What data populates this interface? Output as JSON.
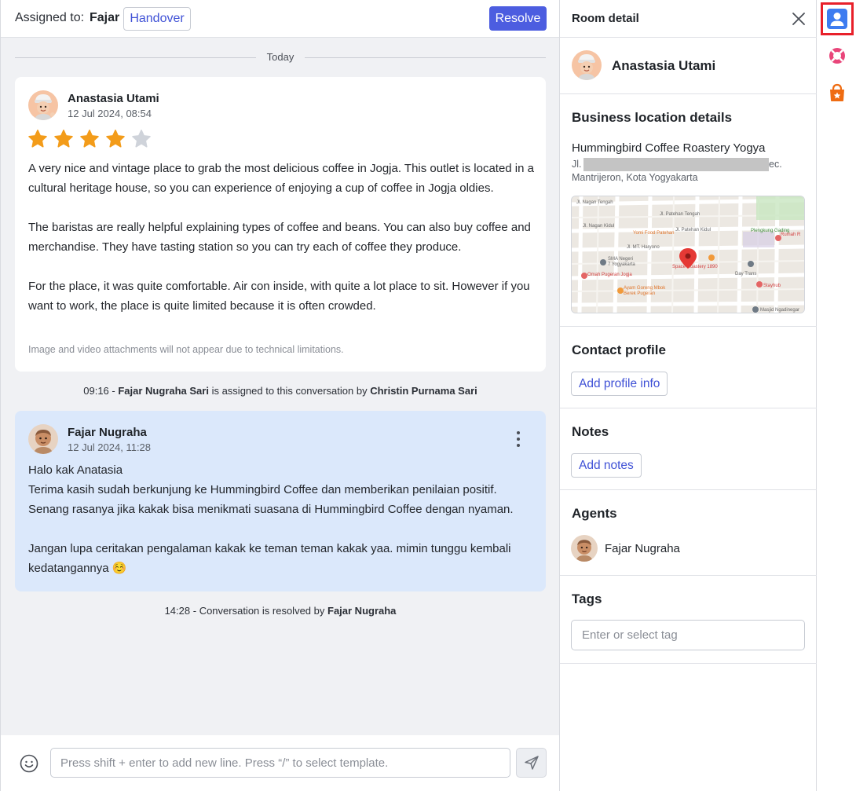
{
  "header": {
    "assigned_label": "Assigned to:",
    "assigned_name": "Fajar",
    "handover_label": "Handover",
    "resolve_label": "Resolve"
  },
  "conversation": {
    "date_divider": "Today",
    "review": {
      "sender": "Anastasia Utami",
      "timestamp": "12 Jul 2024, 08:54",
      "rating": 4,
      "rating_max": 5,
      "text": "A very nice and vintage place to grab the most delicious coffee in Jogja. This outlet is located in a cultural heritage house, so you can experience of enjoying a cup of coffee in Jogja oldies.\n\nThe baristas are really helpful explaining types of coffee and beans. You can also buy coffee and merchandise. They have tasting station so you can try each of coffee they produce.\n\nFor the place, it was quite comfortable. Air con inside, with quite a lot place to sit. However if you want to work, the place is quite limited because it is often crowded.",
      "attachment_note": "Image and video attachments will not appear due to technical limitations."
    },
    "system_assign": {
      "time": "09:16",
      "separator": " - ",
      "agent": "Fajar Nugraha Sari",
      "middle": " is assigned to this conversation by ",
      "by": "Christin Purnama Sari"
    },
    "reply": {
      "sender": "Fajar Nugraha",
      "timestamp": "12 Jul 2024, 11:28",
      "text": "Halo kak Anatasia\nTerima kasih sudah berkunjung ke Hummingbird Coffee dan memberikan penilaian positif. Senang rasanya jika kakak bisa menikmati suasana di Hummingbird Coffee dengan nyaman.\n\nJangan lupa ceritakan pengalaman kakak ke teman teman kakak yaa. mimin tunggu kembali kedatangannya ☺️"
    },
    "system_resolve": {
      "time": "14:28",
      "separator": " - ",
      "middle": "Conversation is resolved by ",
      "by": "Fajar Nugraha"
    }
  },
  "composer": {
    "placeholder": "Press shift + enter to add new line. Press “/” to select template."
  },
  "detail": {
    "title": "Room detail",
    "contact_name": "Anastasia Utami",
    "business": {
      "title": "Business location details",
      "name": "Hummingbird Coffee Roastery Yogya",
      "address_start": "Jl.",
      "address_end": "ec.",
      "address_line2": "Mantrijeron, Kota Yogyakarta",
      "map_labels": {
        "jl_nagan_tengah": "Jl. Nagan Tengah",
        "jl_patehan_tengah": "Jl. Patehan Tengah",
        "jl_nagan_kidul": "Jl. Nagan Kidul",
        "yomi": "Yomi Food Patehan",
        "jl_patehan_kidul": "Jl. Patehan Kidul",
        "jl_mt_haryono": "Jl. MT. Haryono",
        "sma": "SMA Negeri",
        "sma2": "7 Yogyakarta",
        "space": "Space Roastery 1890",
        "omah": "Omah Pugeran Jogja",
        "ayam": "Ayam Goreng Mbok",
        "ayam2": "Berek Pugeran",
        "day_trans": "Day Trans",
        "stayhub": "Stayhub",
        "plengkung": "Plengkung Gading",
        "rumah": "Rumah R",
        "masjid": "Masjid Ngadinegar"
      }
    },
    "profile": {
      "title": "Contact profile",
      "button": "Add profile info"
    },
    "notes": {
      "title": "Notes",
      "button": "Add notes"
    },
    "agents": {
      "title": "Agents",
      "name": "Fajar Nugraha"
    },
    "tags": {
      "title": "Tags",
      "placeholder": "Enter or select tag"
    }
  },
  "colors": {
    "accent": "#4c5de0",
    "star_on": "#f39c1a",
    "star_off": "#cfd3da",
    "reply_bg": "#dbe8fb",
    "rail_highlight": "#e8202a"
  },
  "icons": {
    "emoji": "emoji-smile-icon",
    "send": "send-plane-icon",
    "close": "close-icon",
    "kebab": "kebab-menu-icon",
    "rail": [
      "user-contact-icon",
      "lifebuoy-support-icon",
      "shop-bag-icon"
    ]
  }
}
